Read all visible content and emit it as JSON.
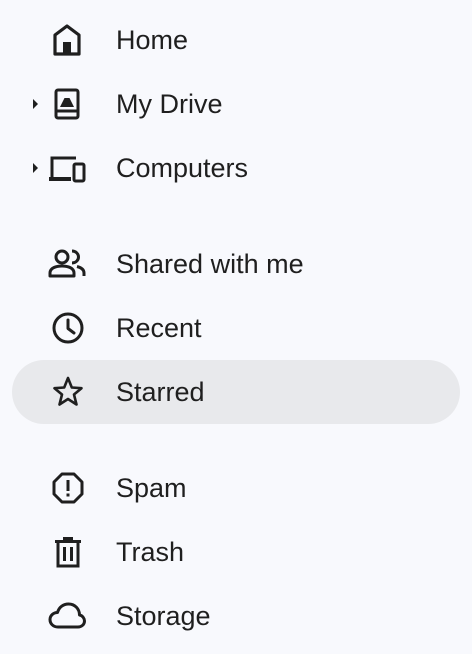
{
  "sidebar": {
    "items": [
      {
        "label": "Home",
        "icon": "home-icon",
        "expandable": false,
        "selected": false
      },
      {
        "label": "My Drive",
        "icon": "drive-icon",
        "expandable": true,
        "selected": false
      },
      {
        "label": "Computers",
        "icon": "computers-icon",
        "expandable": true,
        "selected": false
      },
      {
        "label": "Shared with me",
        "icon": "people-icon",
        "expandable": false,
        "selected": false
      },
      {
        "label": "Recent",
        "icon": "clock-icon",
        "expandable": false,
        "selected": false
      },
      {
        "label": "Starred",
        "icon": "star-icon",
        "expandable": false,
        "selected": true
      },
      {
        "label": "Spam",
        "icon": "spam-icon",
        "expandable": false,
        "selected": false
      },
      {
        "label": "Trash",
        "icon": "trash-icon",
        "expandable": false,
        "selected": false
      },
      {
        "label": "Storage",
        "icon": "cloud-icon",
        "expandable": false,
        "selected": false
      }
    ]
  },
  "colors": {
    "background": "#f8f9fd",
    "selected_background": "#e8e9ec",
    "text": "#1f1f1f"
  }
}
